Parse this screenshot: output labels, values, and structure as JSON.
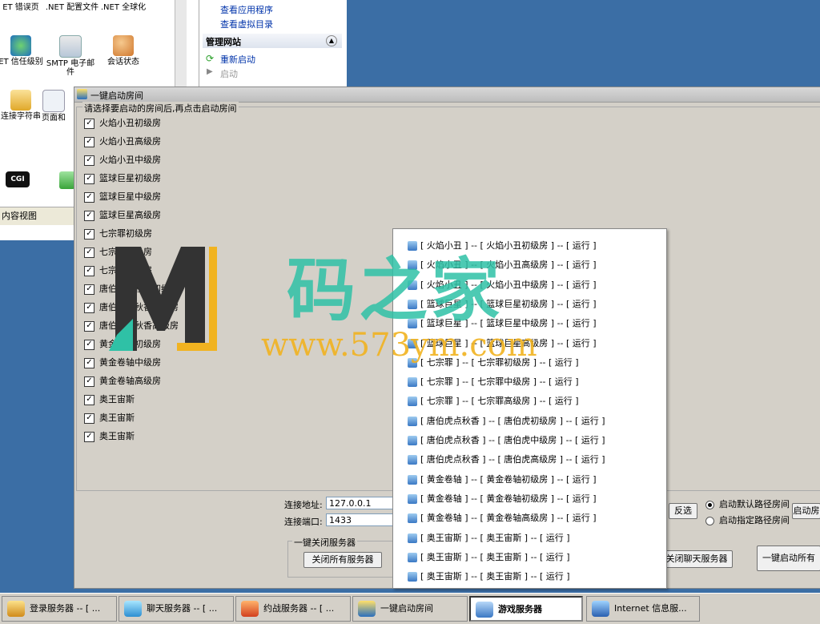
{
  "iis": {
    "icons": [
      {
        "label": "ET 错误页"
      },
      {
        "label": ".NET 配置文件"
      },
      {
        "label": ".NET 全球化"
      },
      {
        "label": "ET 信任级别"
      },
      {
        "label": "SMTP 电子邮件"
      },
      {
        "label": "会话状态"
      },
      {
        "label": "连接字符串"
      },
      {
        "label": "页面和"
      },
      {
        "label": "CGI"
      }
    ],
    "status": "内容视图",
    "actions": {
      "links": [
        "查看应用程序",
        "查看虚拟目录"
      ],
      "section_title": "管理网站",
      "restart": "重新启动",
      "start": "启动"
    }
  },
  "dialog": {
    "title": "一键启动房间",
    "instruction": "请选择要启动的房间后,再点击启动房间",
    "rooms": [
      "火焰小丑初级房",
      "火焰小丑高级房",
      "火焰小丑中级房",
      "篮球巨星初级房",
      "篮球巨星中级房",
      "篮球巨星高级房",
      "七宗罪初级房",
      "七宗罪中级房",
      "七宗罪高级房",
      "唐伯虎点秋香初级房",
      "唐伯虎点秋香中级房",
      "唐伯虎点秋香高级房",
      "黄金卷轴初级房",
      "黄金卷轴中级房",
      "黄金卷轴高级房",
      "奥王宙斯",
      "奥王宙斯",
      "奥王宙斯"
    ],
    "connect_addr_label": "连接地址:",
    "connect_addr_value": "127.0.0.1",
    "connect_port_label": "连接端口:",
    "connect_port_value": "1433",
    "invert_button": "反选",
    "radio_default": "启动默认路径房间",
    "radio_custom": "启动指定路径房间",
    "start_room_button": "启动房",
    "close_group_label": "一键关闭服务器",
    "close_all_button": "关闭所有服务器",
    "close_chat_button": "关闭聊天服务器",
    "start_all_button": "一键启动所有"
  },
  "popup": {
    "items": [
      "[ 火焰小丑 ] -- [ 火焰小丑初级房 ] -- [ 运行 ]",
      "[ 火焰小丑 ] -- [ 火焰小丑高级房 ] -- [ 运行 ]",
      "[ 火焰小丑 ] -- [ 火焰小丑中级房 ] -- [ 运行 ]",
      "[ 篮球巨星 ] -- [ 篮球巨星初级房 ] -- [ 运行 ]",
      "[ 篮球巨星 ] -- [ 篮球巨星中级房 ] -- [ 运行 ]",
      "[ 篮球巨星 ] -- [ 篮球巨星高级房 ] -- [ 运行 ]",
      "[ 七宗罪 ] -- [ 七宗罪初级房 ] -- [ 运行 ]",
      "[ 七宗罪 ] -- [ 七宗罪中级房 ] -- [ 运行 ]",
      "[ 七宗罪 ] -- [ 七宗罪高级房 ] -- [ 运行 ]",
      "[ 唐伯虎点秋香 ] -- [ 唐伯虎初级房 ] -- [ 运行 ]",
      "[ 唐伯虎点秋香 ] -- [ 唐伯虎中级房 ] -- [ 运行 ]",
      "[ 唐伯虎点秋香 ] -- [ 唐伯虎高级房 ] -- [ 运行 ]",
      "[ 黄金卷轴 ] -- [ 黄金卷轴初级房 ] -- [ 运行 ]",
      "[ 黄金卷轴 ] -- [ 黄金卷轴初级房 ] -- [ 运行 ]",
      "[ 黄金卷轴 ] -- [ 黄金卷轴高级房 ] -- [ 运行 ]",
      "[ 奥王宙斯 ] -- [ 奥王宙斯 ] -- [ 运行 ]",
      "[ 奥王宙斯 ] -- [ 奥王宙斯 ] -- [ 运行 ]",
      "[ 奥王宙斯 ] -- [ 奥王宙斯 ] -- [ 运行 ]"
    ]
  },
  "watermark": {
    "text": "码之家",
    "url": "www.573ym.com"
  },
  "taskbar": {
    "items": [
      {
        "label": "登录服务器 -- [ ...",
        "icon": "login-server-icon"
      },
      {
        "label": "聊天服务器 -- [ ...",
        "icon": "chat-server-icon"
      },
      {
        "label": "约战服务器 -- [ ...",
        "icon": "battle-server-icon"
      },
      {
        "label": "一键启动房间",
        "icon": "launch-rooms-icon"
      },
      {
        "label": "游戏服务器",
        "icon": "game-server-icon"
      },
      {
        "label": "Internet 信息服...",
        "icon": "iis-icon"
      }
    ]
  },
  "colors": {
    "desktop": "#3b6ea5",
    "dialog_bg": "#d4d0c8",
    "link": "#0033aa",
    "watermark_green": "#2fc1a6",
    "watermark_yellow": "#f1b320"
  }
}
